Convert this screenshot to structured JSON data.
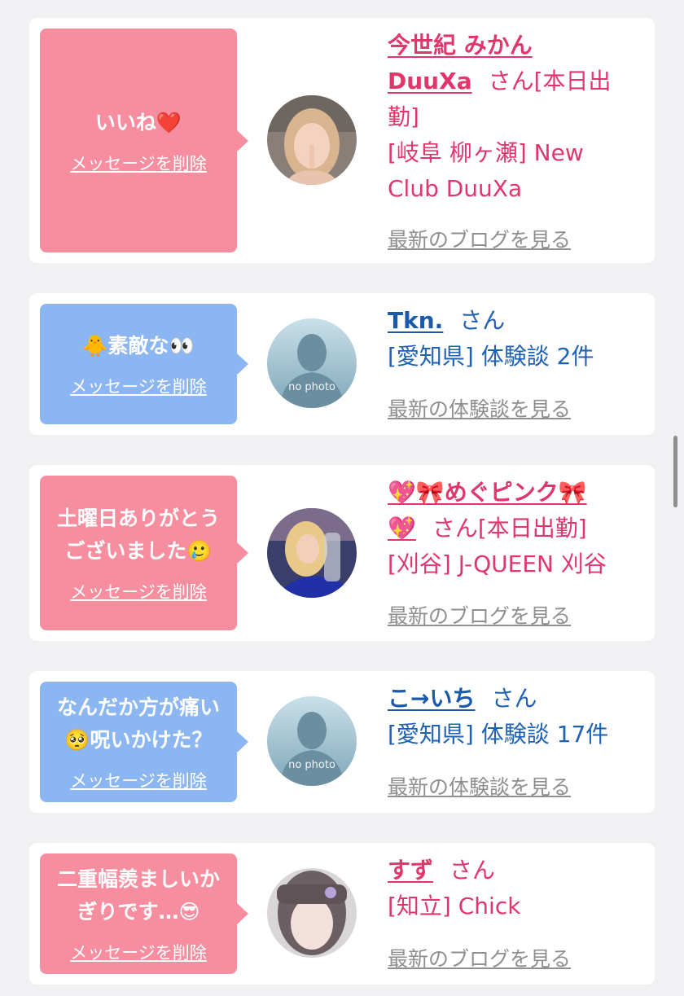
{
  "colors": {
    "pink_bubble": "#f68e9f",
    "blue_bubble": "#8cb6f2",
    "pink_text": "#e0366c",
    "blue_text": "#1f61b3"
  },
  "common": {
    "delete_label": "メッセージを削除",
    "san": "さん"
  },
  "cards": [
    {
      "message": "いいね❤️",
      "name_line1": "今世紀 みかん",
      "name_line2": "DuuXa",
      "suffix": "さん[本日出",
      "suffix2": "勤]",
      "detail1": "[岐阜 柳ヶ瀬] New",
      "detail2": "Club DuuXa",
      "link": "最新のブログを見る",
      "avatar": "profile-photo"
    },
    {
      "message": "🐥素敵な👀",
      "name": "Tkn.",
      "detail1": "[愛知県] 体験談 2件",
      "link": "最新の体験談を見る",
      "avatar_text": "no photo"
    },
    {
      "message_line1": "土曜日ありがとう",
      "message_line2": "ございました🥲",
      "name_line1": "💖🎀めぐピンク🎀",
      "name_line2": "💖",
      "suffix": "さん[本日出勤]",
      "detail1": "[刈谷] J-QUEEN 刈谷",
      "link": "最新のブログを見る",
      "avatar": "profile-photo"
    },
    {
      "message_line1": "なんだか方が痛い",
      "message_line2": "🥺呪いかけた？",
      "name": "こ→いち",
      "detail1": "[愛知県] 体験談 17件",
      "link": "最新の体験談を見る",
      "avatar_text": "no photo"
    },
    {
      "message_line1": "二重幅羨ましいか",
      "message_line2": "ぎりです…😎",
      "name": "すず",
      "detail1": "[知立] Chick",
      "link": "最新のブログを見る",
      "avatar": "profile-photo"
    }
  ]
}
